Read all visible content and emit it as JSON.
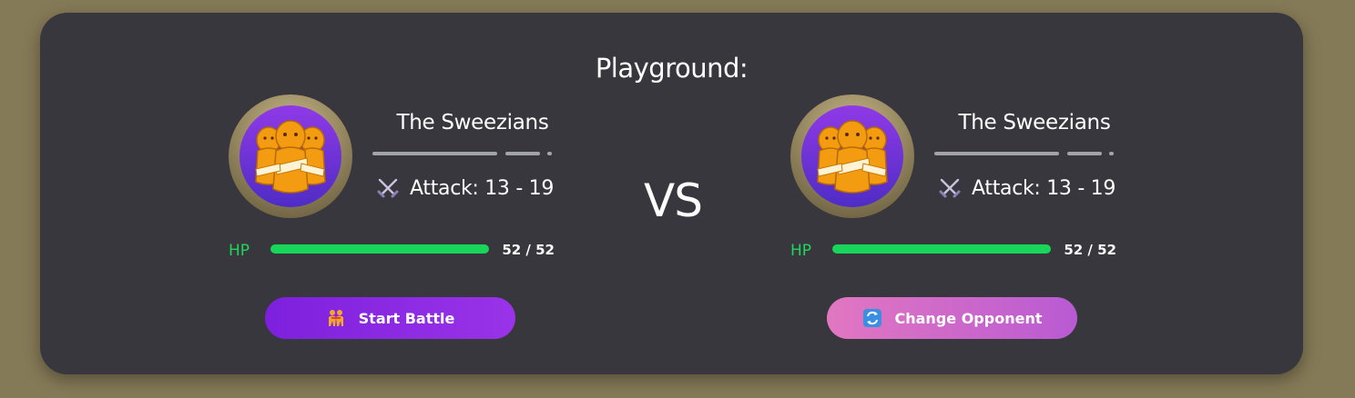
{
  "page": {
    "title": "Playground:",
    "vs_label": "VS"
  },
  "fighters": [
    {
      "name": "The Sweezians",
      "avatar_icon": "sweezians-avatar",
      "attack_icon": "crossed-swords-icon",
      "attack_text": "Attack: 13 - 19",
      "hp_label": "HP",
      "hp_current": 52,
      "hp_max": 52,
      "hp_text": "52 / 52",
      "hp_fraction": 1.0
    },
    {
      "name": "The Sweezians",
      "avatar_icon": "sweezians-avatar",
      "attack_icon": "crossed-swords-icon",
      "attack_text": "Attack: 13 - 19",
      "hp_label": "HP",
      "hp_current": 52,
      "hp_max": 52,
      "hp_text": "52 / 52",
      "hp_fraction": 1.0
    }
  ],
  "actions": {
    "start_battle": {
      "label": "Start Battle",
      "icon": "wrestlers-icon"
    },
    "change_opponent": {
      "label": "Change Opponent",
      "icon": "refresh-icon"
    }
  },
  "colors": {
    "background": "#857a57",
    "panel": "#37373d",
    "hp_green": "#17d65a",
    "start_button": "#8a28e2",
    "change_button": "#d16ac9"
  }
}
